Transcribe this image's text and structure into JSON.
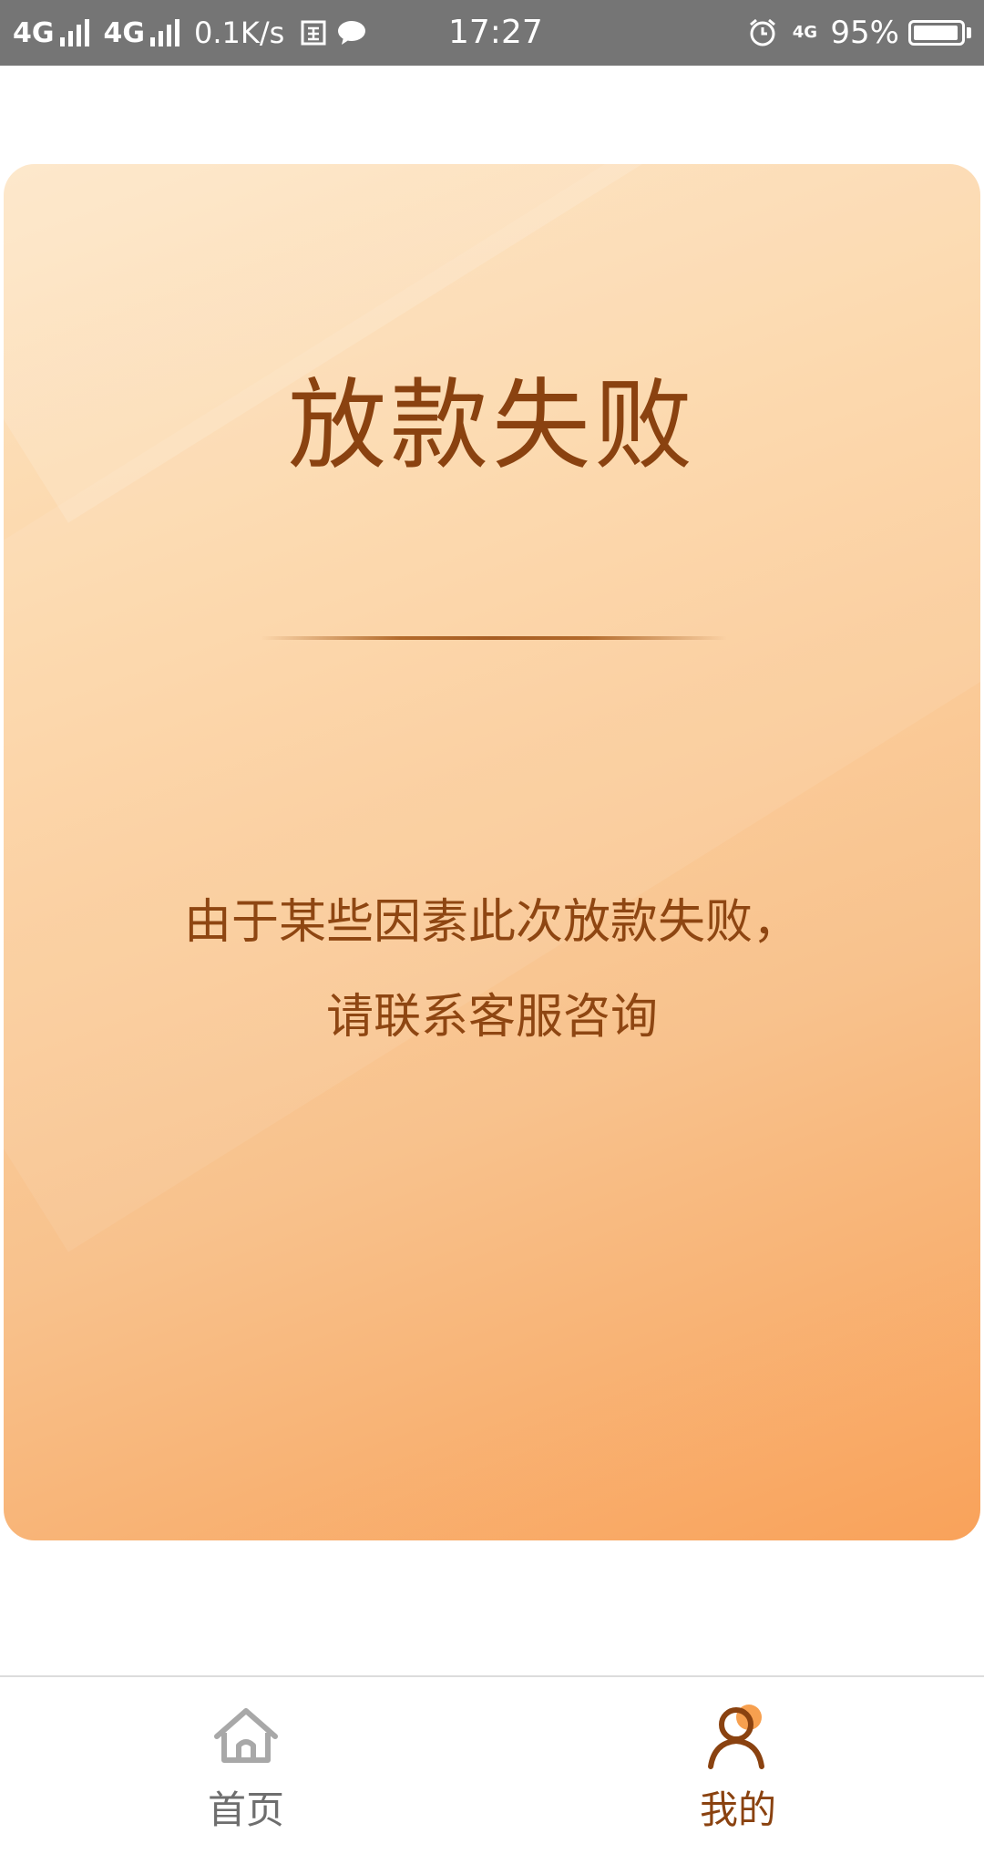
{
  "status_bar": {
    "network1": "4G",
    "network2": "4G",
    "speed": "0.1K/s",
    "time": "17:27",
    "small_network": "4G",
    "battery": "95%",
    "battery_level": 0.95
  },
  "card": {
    "title": "放款失败",
    "message_line1": "由于某些因素此次放款失败，",
    "message_line2": "请联系客服咨询"
  },
  "bottom_nav": {
    "items": [
      {
        "label": "首页",
        "icon": "home-icon",
        "active": false
      },
      {
        "label": "我的",
        "icon": "user-icon",
        "active": true
      }
    ]
  },
  "colors": {
    "status_bar_bg": "#757575",
    "card_gradient_start": "#fde5c4",
    "card_gradient_end": "#f9a25a",
    "title_text": "#8a4210",
    "active_tab": "#8a4210",
    "inactive_tab": "#6e6e6e",
    "active_icon_accent": "#f7a04f"
  }
}
